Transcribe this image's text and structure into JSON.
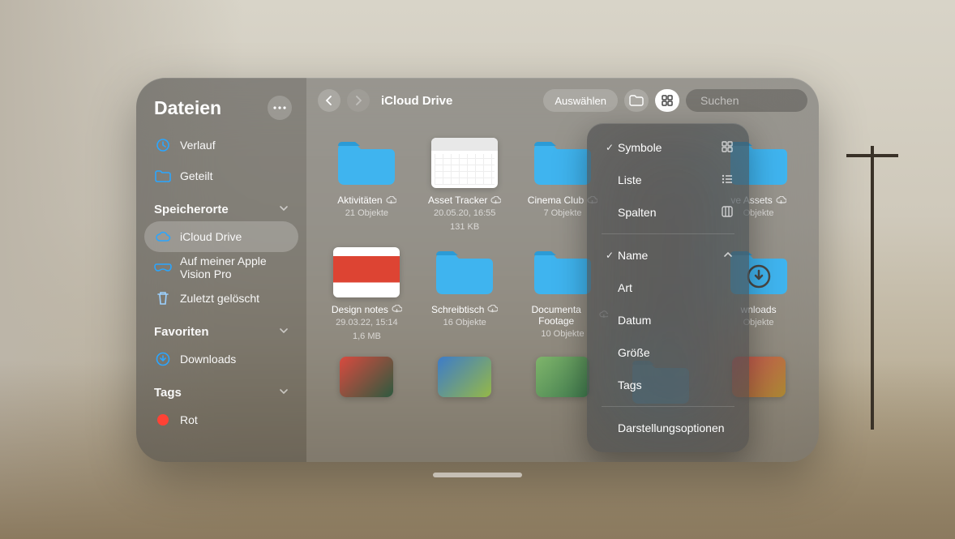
{
  "sidebar": {
    "title": "Dateien",
    "items_top": [
      {
        "label": "Verlauf",
        "icon": "clock-icon",
        "color": "#2aa6ff"
      },
      {
        "label": "Geteilt",
        "icon": "shared-folder-icon",
        "color": "#2aa6ff"
      }
    ],
    "section_locations": "Speicherorte",
    "locations": [
      {
        "label": "iCloud Drive",
        "icon": "cloud-icon",
        "color": "#2aa6ff",
        "active": true
      },
      {
        "label": "Auf meiner Apple Vision Pro",
        "icon": "visionpro-icon",
        "color": "#2aa6ff",
        "active": false
      },
      {
        "label": "Zuletzt gelöscht",
        "icon": "trash-icon",
        "color": "#9cd1ff",
        "active": false
      }
    ],
    "section_favorites": "Favoriten",
    "favorites": [
      {
        "label": "Downloads",
        "icon": "download-circle-icon",
        "color": "#2aa6ff"
      }
    ],
    "section_tags": "Tags",
    "tags": [
      {
        "label": "Rot",
        "color": "#ff4235"
      }
    ]
  },
  "toolbar": {
    "location": "iCloud Drive",
    "select_label": "Auswählen",
    "search_placeholder": "Suchen"
  },
  "popover": {
    "view": [
      {
        "label": "Symbole",
        "checked": true,
        "icon": "grid-icon"
      },
      {
        "label": "Liste",
        "checked": false,
        "icon": "list-icon"
      },
      {
        "label": "Spalten",
        "checked": false,
        "icon": "columns-icon"
      }
    ],
    "sort": [
      {
        "label": "Name",
        "checked": true,
        "trailing": "sort-asc-icon"
      },
      {
        "label": "Art",
        "checked": false
      },
      {
        "label": "Datum",
        "checked": false
      },
      {
        "label": "Größe",
        "checked": false
      },
      {
        "label": "Tags",
        "checked": false
      }
    ],
    "options_label": "Darstellungsoptionen"
  },
  "files": [
    {
      "name": "Aktivitäten",
      "type": "folder",
      "meta1": "21 Objekte",
      "cloud": true
    },
    {
      "name": "Asset Tracker",
      "type": "spreadsheet",
      "meta1": "20.05.20, 16:55",
      "meta2": "131 KB",
      "cloud": true
    },
    {
      "name": "Cinema Club",
      "type": "folder",
      "meta1": "7 Objekte",
      "cloud": true
    },
    {
      "name": "",
      "type": "folder",
      "hidden_by_popover": true
    },
    {
      "name": "ve Assets",
      "type": "folder",
      "meta1": "Objekte",
      "cloud": true
    },
    {
      "name": "Design notes",
      "type": "image-doc",
      "meta1": "29.03.22, 15:14",
      "meta2": "1,6 MB",
      "cloud": true
    },
    {
      "name": "Schreibtisch",
      "type": "folder",
      "meta1": "16 Objekte",
      "cloud": true
    },
    {
      "name": "Documenta Footage",
      "type": "folder",
      "meta1": "10 Objekte",
      "cloud": true,
      "two_line_name": "Documentary\nFootage"
    },
    {
      "name": "",
      "type": "folder-download",
      "hidden_by_popover": true
    },
    {
      "name": "wnloads",
      "type": "folder-download",
      "meta1": "Objekte"
    },
    {
      "name": "",
      "type": "photo",
      "bg": "linear-gradient(135deg,#d94a3f,#2d5a3f)"
    },
    {
      "name": "",
      "type": "photo",
      "bg": "linear-gradient(135deg,#3d7cc9,#95b847)"
    },
    {
      "name": "",
      "type": "photo",
      "bg": "linear-gradient(135deg,#7fb56b,#3f7a4e)"
    },
    {
      "name": "",
      "type": "folder",
      "partial": true
    },
    {
      "name": "",
      "type": "photo",
      "bg": "linear-gradient(135deg,#c55,#a83)"
    }
  ]
}
